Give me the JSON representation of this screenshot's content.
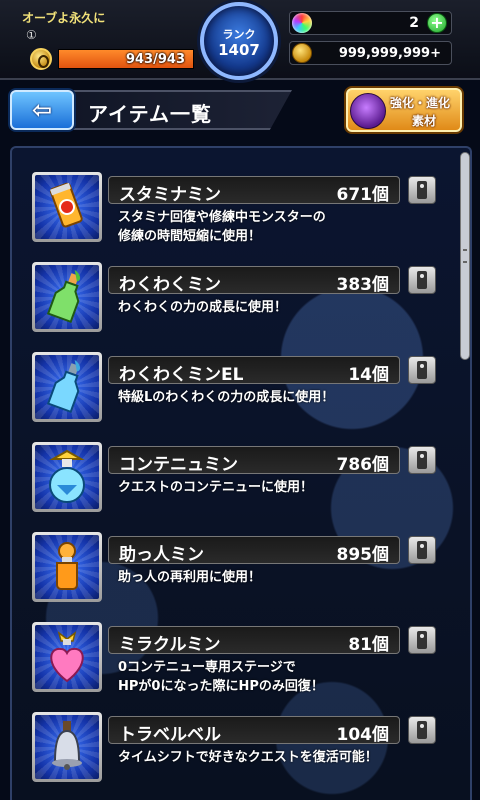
{
  "player": {
    "name": "オーブよ永久に",
    "number": "①",
    "stamina_text": "943/943",
    "stamina_fraction": 1.0
  },
  "rank": {
    "label": "ランク",
    "value": "1407"
  },
  "currency": {
    "orbs": "2",
    "coins": "999,999,999+",
    "plus_label": "+"
  },
  "header": {
    "back_label": "⇦",
    "title": "アイテム一覧",
    "evo_line1": "強化・進化",
    "evo_line2": "素材"
  },
  "items": [
    {
      "name": "スタミナミン",
      "count": "671個",
      "desc": "スタミナ回復や修練中モンスターの\n修練の時間短縮に使用！",
      "icon": "stamina-can-icon"
    },
    {
      "name": "わくわくミン",
      "count": "383個",
      "desc": "わくわくの力の成長に使用！",
      "icon": "green-bottle-icon"
    },
    {
      "name": "わくわくミンEL",
      "count": "14個",
      "desc": "特級Lのわくわくの力の成長に使用！",
      "icon": "blue-bottle-icon"
    },
    {
      "name": "コンテニュミン",
      "count": "786個",
      "desc": "クエストのコンテニューに使用！",
      "icon": "round-flask-icon"
    },
    {
      "name": "助っ人ミン",
      "count": "895個",
      "desc": "助っ人の再利用に使用！",
      "icon": "orange-vial-icon"
    },
    {
      "name": "ミラクルミン",
      "count": "81個",
      "desc": "0コンテニュー専用ステージで\nHPが0になった際にHPのみ回復！",
      "icon": "heart-potion-icon"
    },
    {
      "name": "トラベルベル",
      "count": "104個",
      "desc": "タイムシフトで好きなクエストを復活可能！",
      "icon": "bell-icon"
    }
  ],
  "colors": {
    "stamina_fill": "#ff8a2b",
    "panel_border": "#2f4068",
    "icon_bg": "#1433a8"
  }
}
